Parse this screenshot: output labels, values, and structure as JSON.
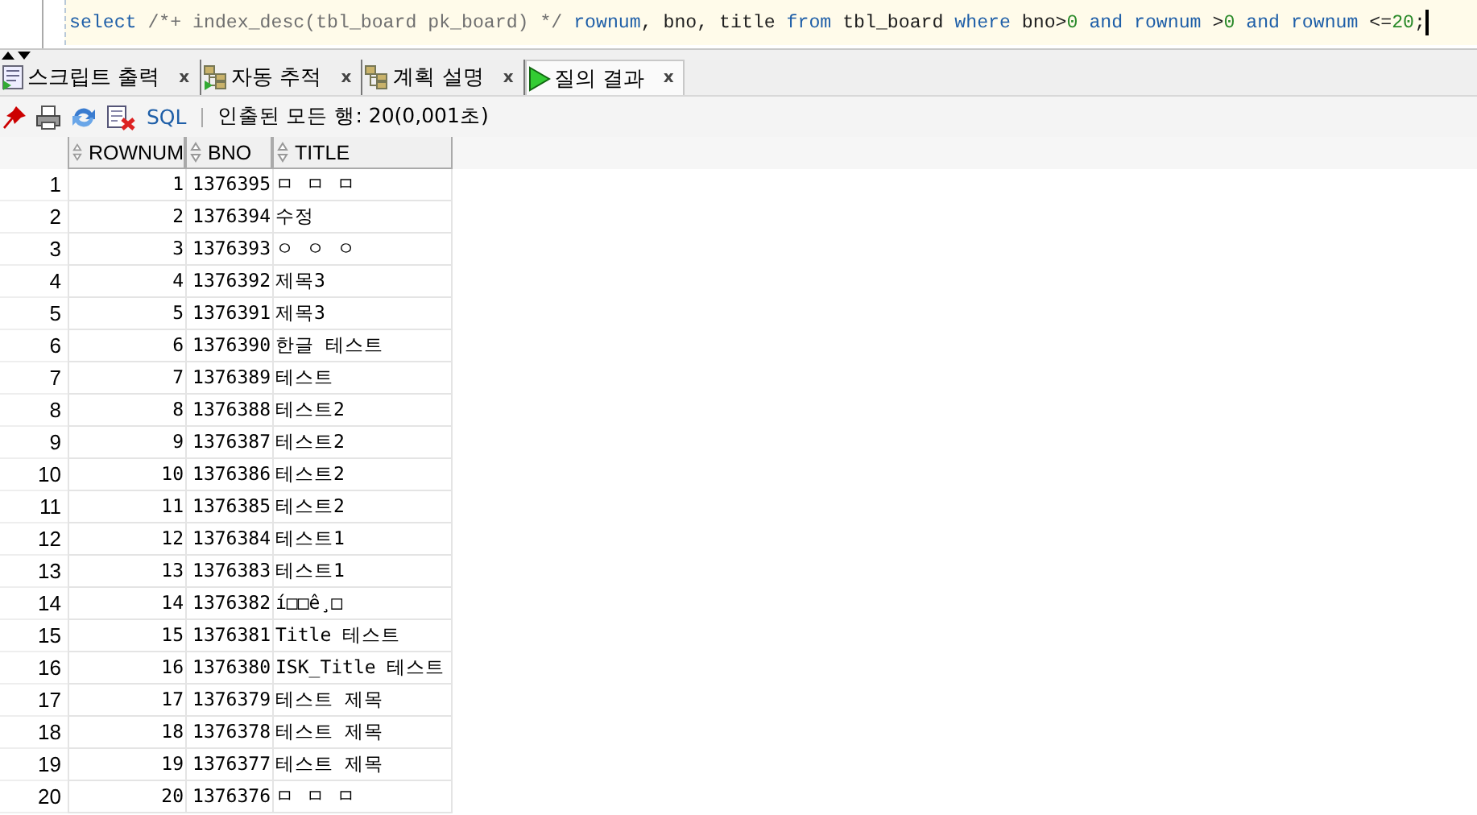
{
  "editor": {
    "sql": [
      {
        "kind": "keyword",
        "text": "select"
      },
      {
        "kind": "comment",
        "text": " /*+ index_desc(tbl_board pk_board) */ "
      },
      {
        "kind": "keyword",
        "text": "rownum"
      },
      {
        "kind": "plain",
        "text": ", bno, title "
      },
      {
        "kind": "keyword",
        "text": "from"
      },
      {
        "kind": "plain",
        "text": " tbl_board "
      },
      {
        "kind": "keyword",
        "text": "where"
      },
      {
        "kind": "plain",
        "text": " bno>"
      },
      {
        "kind": "number",
        "text": "0"
      },
      {
        "kind": "keyword",
        "text": " and rownum "
      },
      {
        "kind": "plain",
        "text": ">"
      },
      {
        "kind": "number",
        "text": "0"
      },
      {
        "kind": "keyword",
        "text": " and rownum "
      },
      {
        "kind": "plain",
        "text": "<="
      },
      {
        "kind": "number",
        "text": "20"
      },
      {
        "kind": "plain",
        "text": ";"
      }
    ]
  },
  "tabs": [
    {
      "label": "스크립트 출력",
      "kind": "script",
      "selected": false,
      "close": "x"
    },
    {
      "label": "자동 추적",
      "kind": "trace",
      "selected": false,
      "close": "x"
    },
    {
      "label": "계획 설명",
      "kind": "plan",
      "selected": false,
      "close": "x"
    },
    {
      "label": "질의 결과",
      "kind": "run",
      "selected": true,
      "close": "x"
    }
  ],
  "toolbar": {
    "sql_link": "SQL",
    "status": "인출된 모든 행: 20(0,001초)"
  },
  "table": {
    "columns": [
      "ROWNUM",
      "BNO",
      "TITLE"
    ],
    "rows": [
      {
        "line": "1",
        "cells": [
          "1",
          "1376395",
          "ㅁ ㅁ ㅁ"
        ]
      },
      {
        "line": "2",
        "cells": [
          "2",
          "1376394",
          "수정"
        ]
      },
      {
        "line": "3",
        "cells": [
          "3",
          "1376393",
          "ㅇ ㅇ ㅇ"
        ]
      },
      {
        "line": "4",
        "cells": [
          "4",
          "1376392",
          "제목3"
        ]
      },
      {
        "line": "5",
        "cells": [
          "5",
          "1376391",
          "제목3"
        ]
      },
      {
        "line": "6",
        "cells": [
          "6",
          "1376390",
          "한글 테스트"
        ]
      },
      {
        "line": "7",
        "cells": [
          "7",
          "1376389",
          "테스트"
        ]
      },
      {
        "line": "8",
        "cells": [
          "8",
          "1376388",
          "테스트2"
        ]
      },
      {
        "line": "9",
        "cells": [
          "9",
          "1376387",
          "테스트2"
        ]
      },
      {
        "line": "10",
        "cells": [
          "10",
          "1376386",
          "테스트2"
        ]
      },
      {
        "line": "11",
        "cells": [
          "11",
          "1376385",
          "테스트2"
        ]
      },
      {
        "line": "12",
        "cells": [
          "12",
          "1376384",
          "테스트1"
        ]
      },
      {
        "line": "13",
        "cells": [
          "13",
          "1376383",
          "테스트1"
        ]
      },
      {
        "line": "14",
        "cells": [
          "14",
          "1376382",
          "í□□ê¸□"
        ]
      },
      {
        "line": "15",
        "cells": [
          "15",
          "1376381",
          "Title 테스트"
        ]
      },
      {
        "line": "16",
        "cells": [
          "16",
          "1376380",
          "ISK_Title 테스트"
        ]
      },
      {
        "line": "17",
        "cells": [
          "17",
          "1376379",
          "테스트 제목"
        ]
      },
      {
        "line": "18",
        "cells": [
          "18",
          "1376378",
          "테스트 제목"
        ]
      },
      {
        "line": "19",
        "cells": [
          "19",
          "1376377",
          "테스트 제목"
        ]
      },
      {
        "line": "20",
        "cells": [
          "20",
          "1376376",
          "ㅁ ㅁ ㅁ"
        ]
      }
    ]
  }
}
